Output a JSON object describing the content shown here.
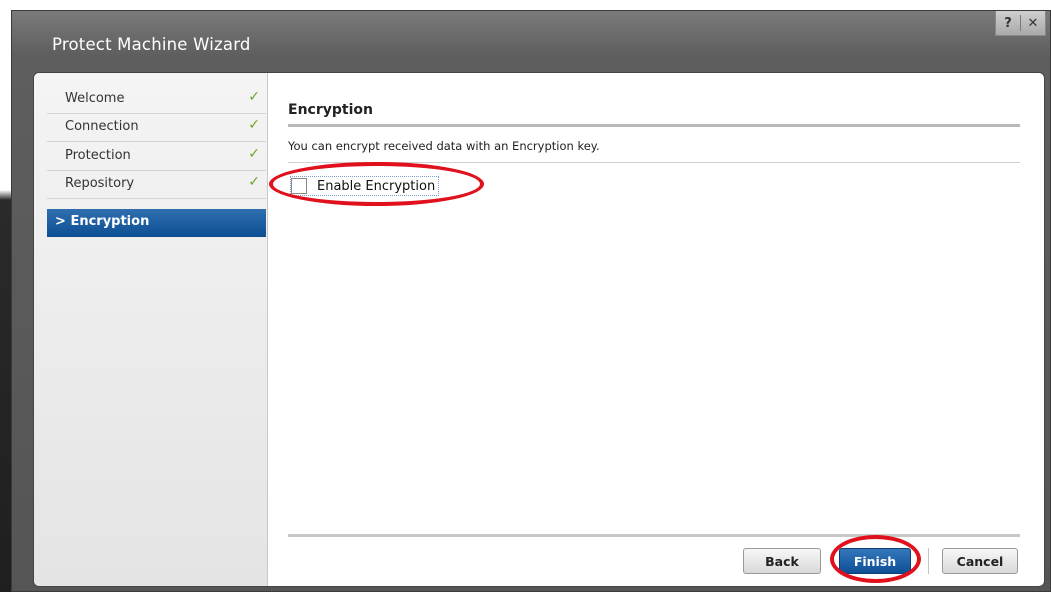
{
  "window": {
    "title": "Protect Machine Wizard",
    "help_label": "?",
    "close_label": "✕"
  },
  "sidebar": {
    "items": [
      {
        "label": "Welcome",
        "done": true
      },
      {
        "label": "Connection",
        "done": true
      },
      {
        "label": "Protection",
        "done": true
      },
      {
        "label": "Repository",
        "done": true
      },
      {
        "label": "Encryption",
        "active": true
      }
    ],
    "check_glyph": "✓",
    "active_glyph": ">"
  },
  "main": {
    "section_title": "Encryption",
    "description": "You can encrypt received data with an Encryption key.",
    "enable_encryption": {
      "label": "Enable Encryption",
      "checked": false
    }
  },
  "footer": {
    "back_label": "Back",
    "finish_label": "Finish",
    "cancel_label": "Cancel"
  },
  "colors": {
    "active_nav": "#0d4f94",
    "check": "#6aa728",
    "highlight_annotation": "#e0101c"
  }
}
